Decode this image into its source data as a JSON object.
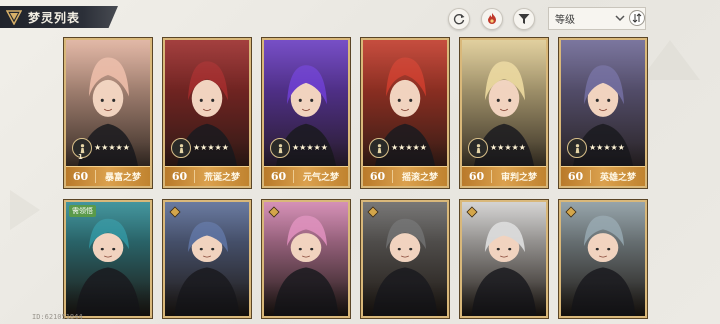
{
  "header": {
    "title": "梦灵列表",
    "sort": {
      "label": "等级"
    }
  },
  "toolbar": {
    "icons": [
      "refresh-icon",
      "filter-flame-icon",
      "filter-funnel-icon",
      "sort-order-icon"
    ]
  },
  "cards_top": [
    {
      "level": "60",
      "rank": "1",
      "stars": "★★★★★",
      "name": "暴富之梦",
      "accent": "#e7b7a3"
    },
    {
      "level": "60",
      "rank": "",
      "stars": "★★★★★",
      "name": "荒诞之梦",
      "accent": "#9e2a2a"
    },
    {
      "level": "60",
      "rank": "",
      "stars": "★★★★★",
      "name": "元气之梦",
      "accent": "#6a3cc9"
    },
    {
      "level": "60",
      "rank": "",
      "stars": "★★★★★",
      "name": "摇滚之梦",
      "accent": "#c73a2a"
    },
    {
      "level": "60",
      "rank": "",
      "stars": "★★★★★",
      "name": "审判之梦",
      "accent": "#e6d39a"
    },
    {
      "level": "60",
      "rank": "",
      "stars": "★★★★★",
      "name": "英雄之梦",
      "accent": "#6f6a9a"
    }
  ],
  "cards_bottom": [
    {
      "tag": "需领悟",
      "accent": "#2f8f9a"
    },
    {
      "tag": "",
      "accent": "#5b6f9c"
    },
    {
      "tag": "",
      "accent": "#d889b6"
    },
    {
      "tag": "",
      "accent": "#6b6b6b"
    },
    {
      "tag": "",
      "accent": "#d7d7d7"
    },
    {
      "tag": "",
      "accent": "#8fa0a8"
    }
  ],
  "footer": {
    "user_id": "ID:621051844"
  }
}
